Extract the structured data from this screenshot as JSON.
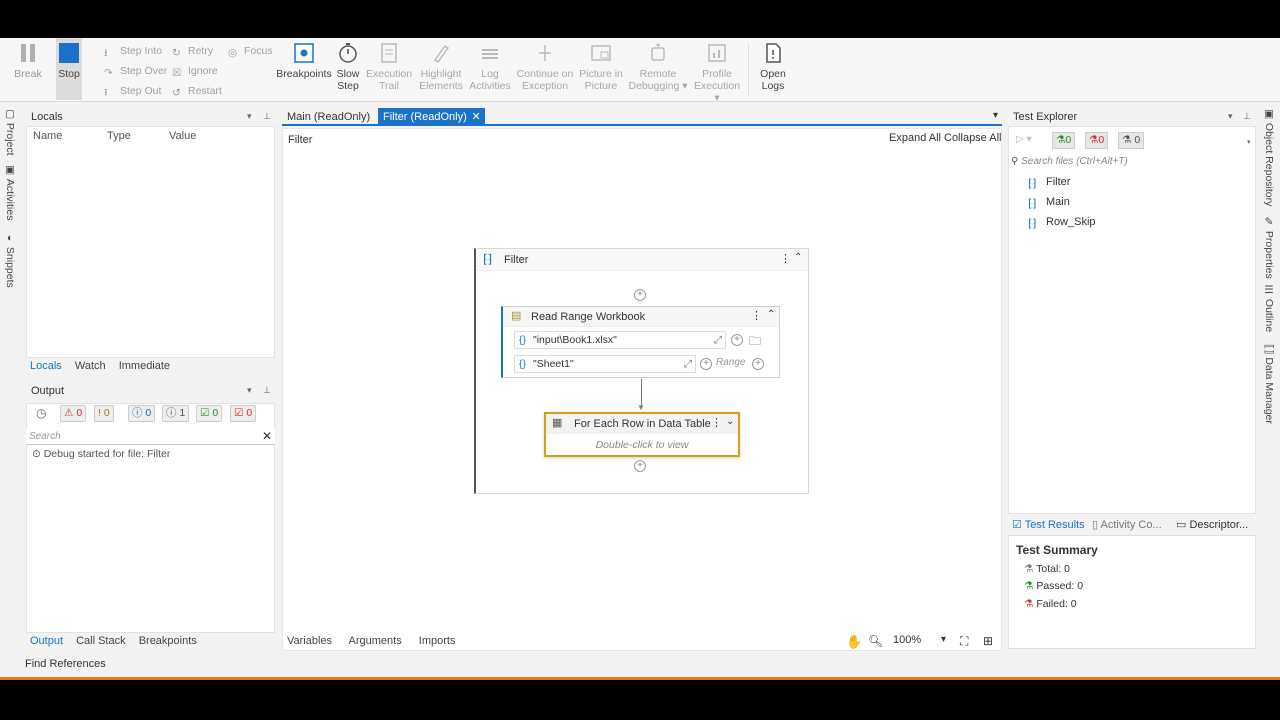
{
  "ribbon": {
    "break_label": "Break",
    "stop_label": "Stop",
    "step_into": "Step Into",
    "step_over": "Step Over",
    "step_out": "Step Out",
    "retry": "Retry",
    "ignore": "Ignore",
    "restart": "Restart",
    "focus": "Focus",
    "breakpoints": "Breakpoints",
    "slow_step_1": "Slow",
    "slow_step_2": "Step",
    "execution_trail_1": "Execution",
    "execution_trail_2": "Trail",
    "highlight_1": "Highlight",
    "highlight_2": "Elements",
    "log_1": "Log",
    "log_2": "Activities",
    "continue_1": "Continue on",
    "continue_2": "Exception",
    "picture_1": "Picture in",
    "picture_2": "Picture",
    "remote_1": "Remote",
    "remote_2": "Debugging",
    "profile_1": "Profile",
    "profile_2": "Execution",
    "open_logs_1": "Open",
    "open_logs_2": "Logs"
  },
  "left_rail": {
    "project": "Project",
    "activities": "Activities",
    "snippets": "Snippets"
  },
  "right_rail": {
    "object_repository": "Object Repository",
    "properties": "Properties",
    "outline": "Outline",
    "data_manager": "Data Manager"
  },
  "locals": {
    "title": "Locals",
    "col_name": "Name",
    "col_type": "Type",
    "col_value": "Value",
    "tabs": [
      "Locals",
      "Watch",
      "Immediate"
    ]
  },
  "output": {
    "title": "Output",
    "badges": [
      "0",
      "0",
      "0",
      "1",
      "0",
      "0"
    ],
    "search_placeholder": "Search",
    "log_line": "Debug started for file: Filter",
    "tabs": [
      "Output",
      "Call Stack",
      "Breakpoints"
    ]
  },
  "designer": {
    "tabs": [
      "Main (ReadOnly)",
      "Filter (ReadOnly)"
    ],
    "breadcrumb": "Filter",
    "expand_all": "Expand All",
    "collapse_all": "Collapse All",
    "sequence_title": "Filter",
    "read_range_title": "Read Range Workbook",
    "arg_file": "\"input\\Book1.xlsx\"",
    "arg_sheet": "\"Sheet1\"",
    "range_placeholder": "Range",
    "for_each_title": "For Each Row in Data Table",
    "for_each_hint": "Double-click to view",
    "bottom_tabs": [
      "Variables",
      "Arguments",
      "Imports"
    ],
    "zoom": "100%"
  },
  "test_explorer": {
    "title": "Test Explorer",
    "passed_count": "0",
    "failed_count": "0",
    "other_count": "0",
    "search_placeholder": "Search files (Ctrl+Alt+T)",
    "files": [
      "Filter",
      "Main",
      "Row_Skip"
    ],
    "result_tabs": [
      "Test Results",
      "Activity Co...",
      "Descriptor..."
    ],
    "summary_title": "Test Summary",
    "total": "Total: 0",
    "passed": "Passed: 0",
    "failed": "Failed: 0"
  },
  "status_bar": {
    "find_references": "Find References"
  },
  "colors": {
    "accent": "#1a73c9",
    "stop": "#1a73c9",
    "for_each_border": "#d4a017",
    "bottom_accent": "#e87722"
  }
}
